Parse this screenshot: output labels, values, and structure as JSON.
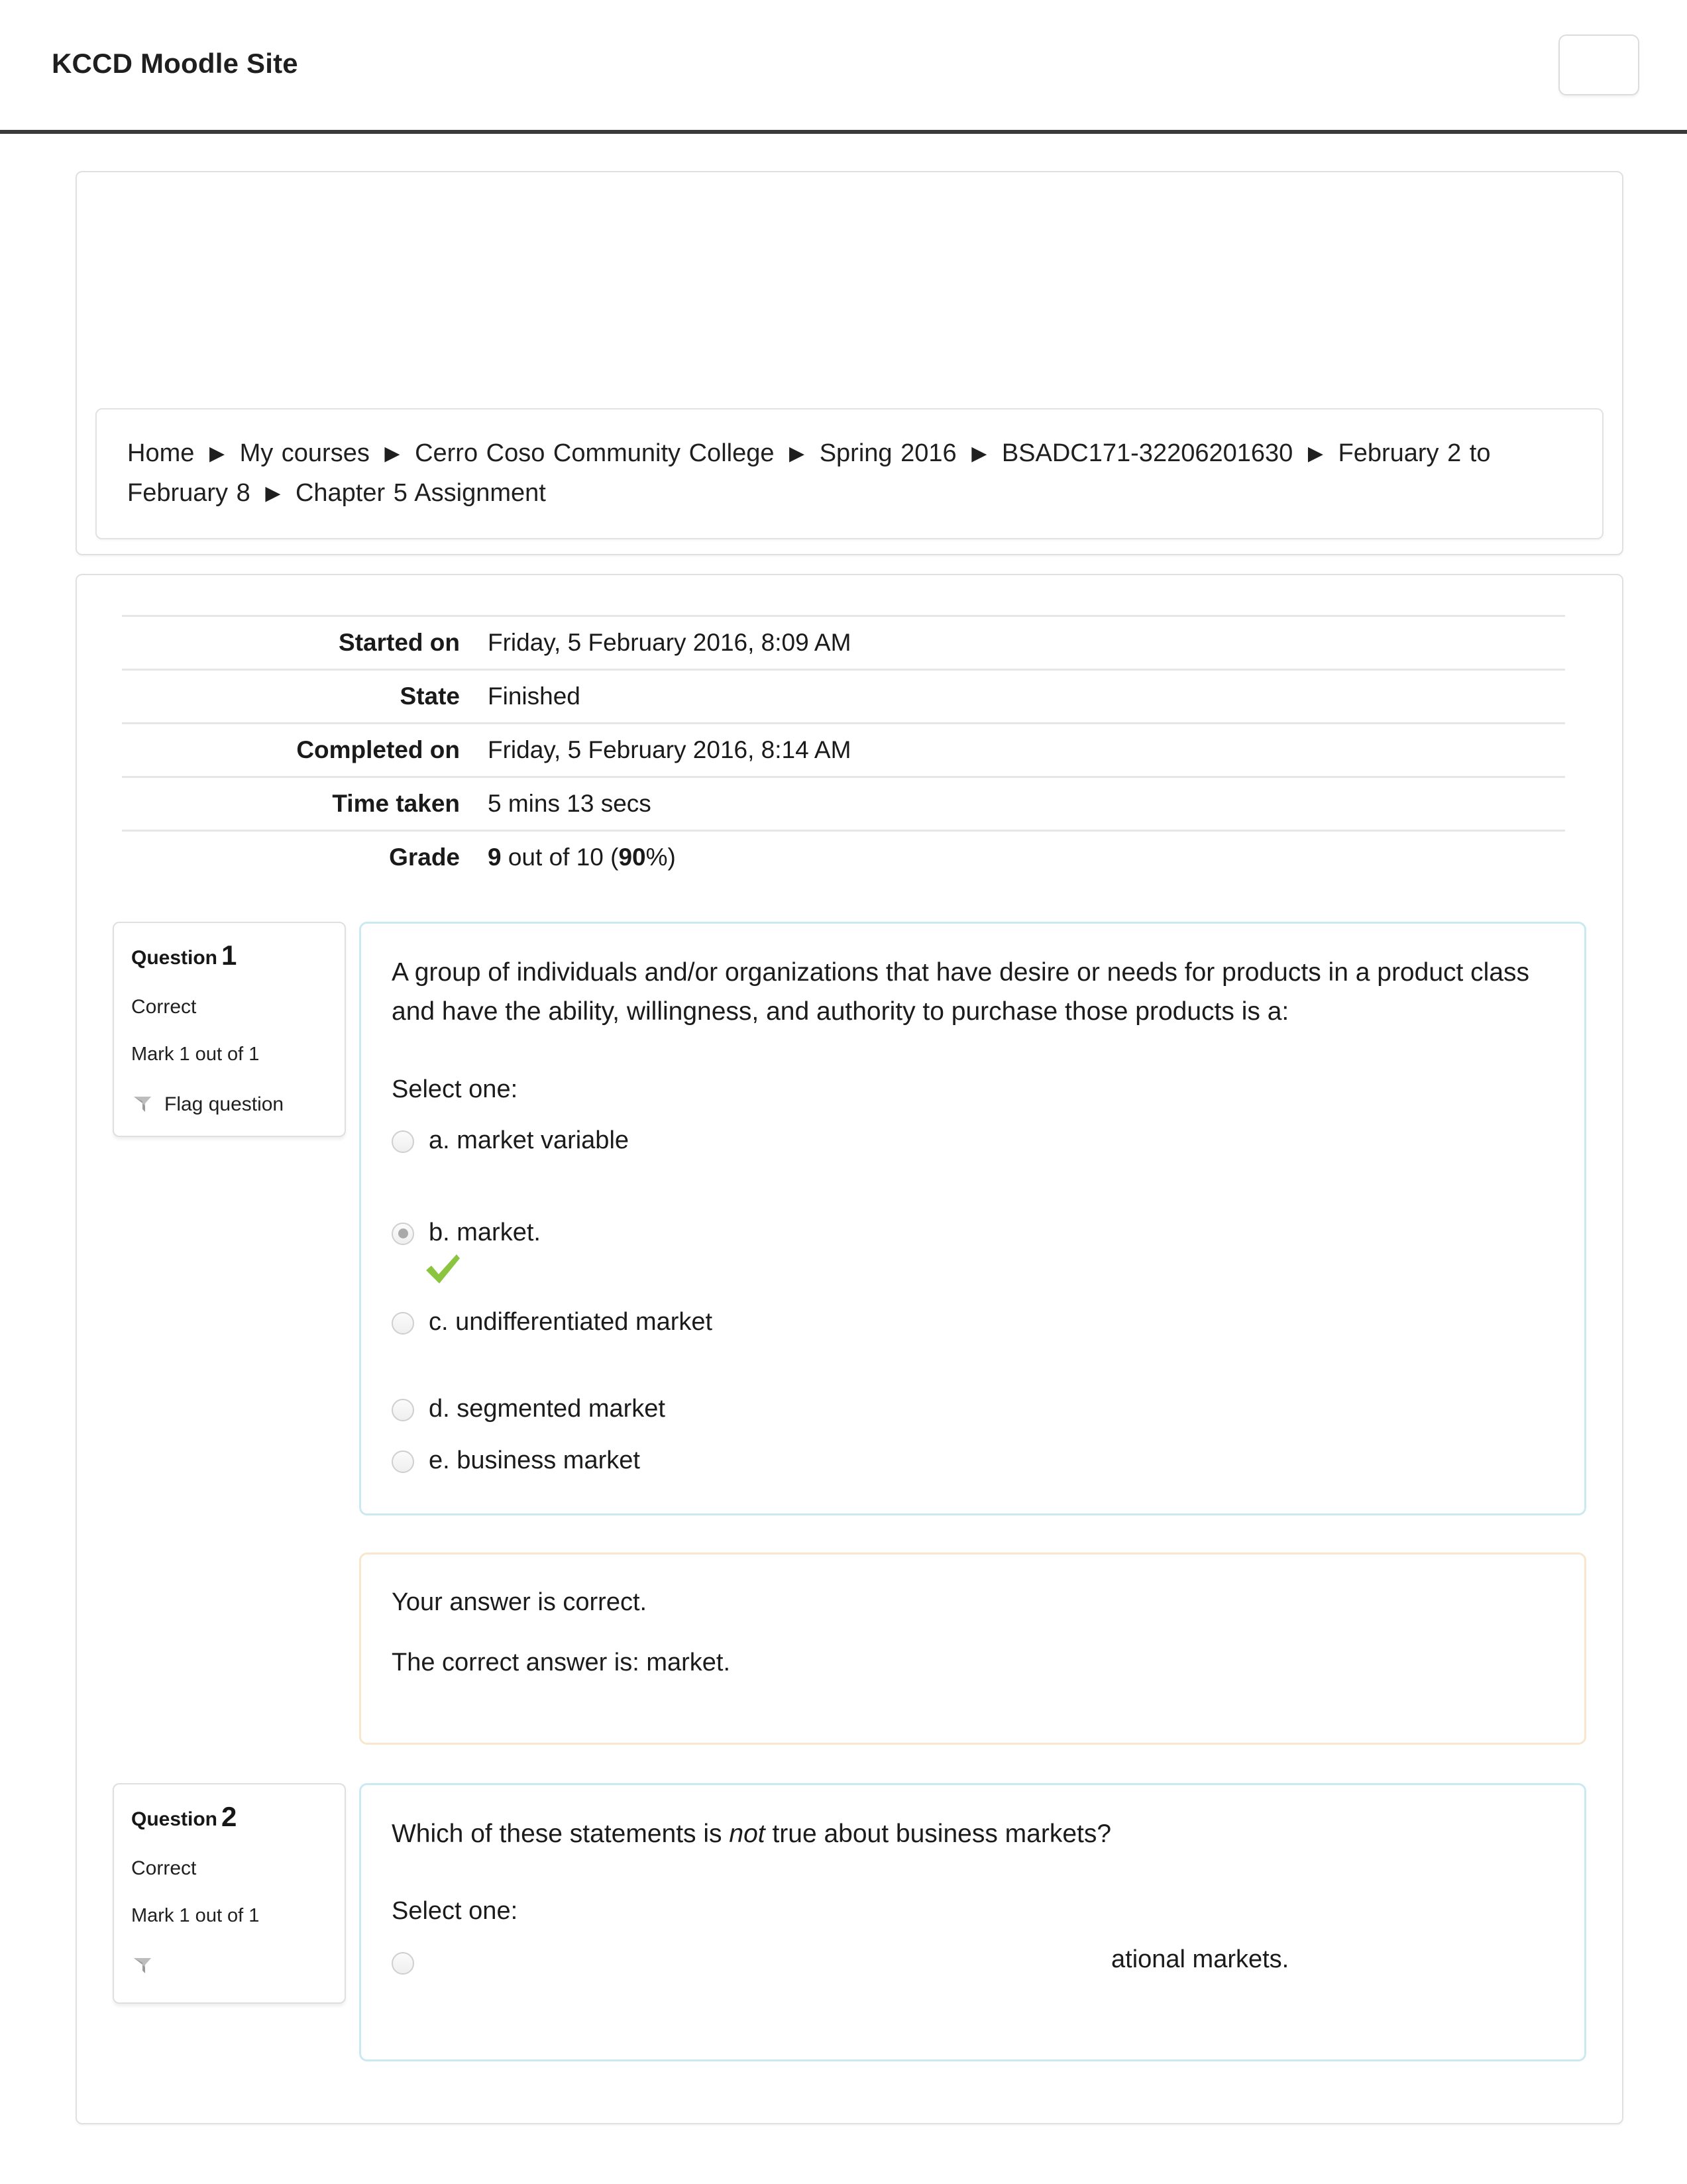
{
  "header": {
    "brand": "KCCD Moodle Site",
    "navbar_toggle_label": ""
  },
  "breadcrumb": {
    "separator": "▶",
    "items": [
      "Home",
      "My courses",
      "Cerro Coso Community College",
      "Spring 2016",
      "BSADC171-32206201630",
      "February 2 to February 8",
      "Chapter 5 Assignment"
    ]
  },
  "summary": {
    "rows": [
      {
        "label": "Started on",
        "value": "Friday, 5 February 2016, 8:09 AM"
      },
      {
        "label": "State",
        "value": "Finished"
      },
      {
        "label": "Completed on",
        "value": "Friday, 5 February 2016, 8:14 AM"
      },
      {
        "label": "Time taken",
        "value": "5 mins 13 secs"
      }
    ],
    "grade": {
      "label": "Grade",
      "score": "9",
      "middle": " out of 10 (",
      "percent": "90",
      "suffix": "%)"
    }
  },
  "questions": [
    {
      "info": {
        "question_word": "Question",
        "number": "1",
        "state": "Correct",
        "grade": "Mark 1 out of 1",
        "flag_label": "Flag question"
      },
      "text": "A group of individuals and/or organizations that have desire or needs for products in a product class and have the ability, willingness, and authority to purchase those products is a:",
      "select_prompt": "Select one:",
      "options": [
        {
          "label": "a. market variable",
          "checked": false,
          "correct": false
        },
        {
          "label": "b. market.",
          "checked": true,
          "correct": true
        },
        {
          "label": "c. undifferentiated market",
          "checked": false,
          "correct": false
        },
        {
          "label": "d. segmented market",
          "checked": false,
          "correct": false
        },
        {
          "label": "e. business market",
          "checked": false,
          "correct": false
        }
      ],
      "feedback": {
        "line1": "Your answer is correct.",
        "line2": "The correct answer is: market."
      }
    },
    {
      "info": {
        "question_word": "Question",
        "number": "2",
        "state": "Correct",
        "grade": "Mark 1 out of 1",
        "flag_label": ""
      },
      "text_before": "Which of these statements is ",
      "text_em": "not",
      "text_after": " true about business markets?",
      "select_prompt": "Select one:",
      "options": [
        {
          "label": "ational markets.",
          "checked": false,
          "correct": false
        }
      ]
    }
  ],
  "colors": {
    "question_border": "#cbe9f0",
    "feedback_border": "#f8e6cd",
    "correct_tick": "#8bc53f",
    "panel_border": "#e0e0e0",
    "navbar_rule": "#3a3a3a"
  }
}
